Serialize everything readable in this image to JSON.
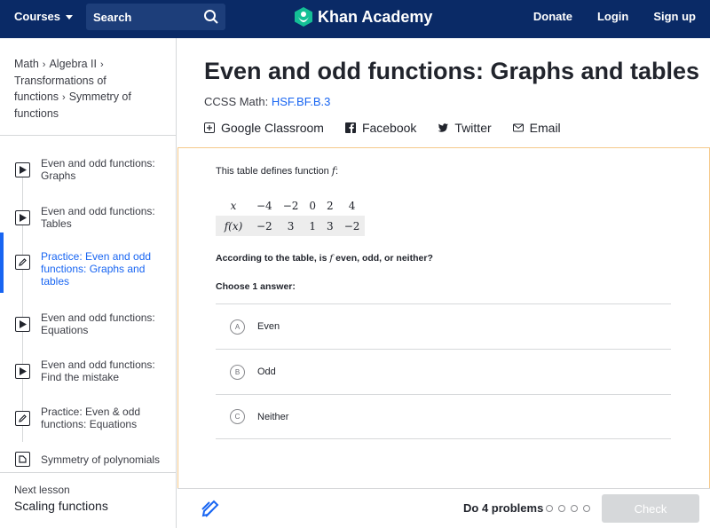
{
  "topbar": {
    "courses_label": "Courses",
    "search_placeholder": "Search",
    "logo_text": "Khan Academy",
    "donate": "Donate",
    "login": "Login",
    "signup": "Sign up"
  },
  "sidebar": {
    "breadcrumbs": [
      "Math",
      "Algebra II",
      "Transformations of functions",
      "Symmetry of functions"
    ],
    "lessons": [
      {
        "label": "Even and odd functions: Graphs",
        "icon": "play-icon"
      },
      {
        "label": "Even and odd functions: Tables",
        "icon": "play-icon"
      },
      {
        "label": "Practice: Even and odd functions: Graphs and tables",
        "icon": "pencil-icon"
      },
      {
        "label": "Even and odd functions: Equations",
        "icon": "play-icon"
      },
      {
        "label": "Even and odd functions: Find the mistake",
        "icon": "play-icon"
      },
      {
        "label": "Practice: Even & odd functions: Equations",
        "icon": "pencil-icon"
      },
      {
        "label": "Symmetry of polynomials",
        "icon": "article-icon"
      }
    ],
    "next_lesson_label": "Next lesson",
    "next_lesson_title": "Scaling functions"
  },
  "main": {
    "title": "Even and odd functions: Graphs and tables",
    "ccss_prefix": "CCSS Math:",
    "ccss_code": "HSF.BF.B.3",
    "shares": [
      "Google Classroom",
      "Facebook",
      "Twitter",
      "Email"
    ]
  },
  "exercise": {
    "intro": "This table defines function",
    "intro_var": "f",
    "table": {
      "row1_head": "x",
      "row1": [
        "−4",
        "−2",
        "0",
        "2",
        "4"
      ],
      "row2_head": "f(x)",
      "row2": [
        "−2",
        "3",
        "1",
        "3",
        "−2"
      ]
    },
    "question_prefix": "According to the table, is",
    "question_var": "f",
    "question_suffix": "even, odd, or neither?",
    "choose_label": "Choose 1 answer:",
    "choices": [
      {
        "letter": "A",
        "text": "Even"
      },
      {
        "letter": "B",
        "text": "Odd"
      },
      {
        "letter": "C",
        "text": "Neither"
      }
    ]
  },
  "footer": {
    "do_problems": "Do 4 problems",
    "check_label": "Check"
  },
  "colors": {
    "topbar": "#0a2a66",
    "accent_blue": "#1865f2",
    "exercise_border": "#f5c98a",
    "check_disabled": "#d6d8da"
  }
}
